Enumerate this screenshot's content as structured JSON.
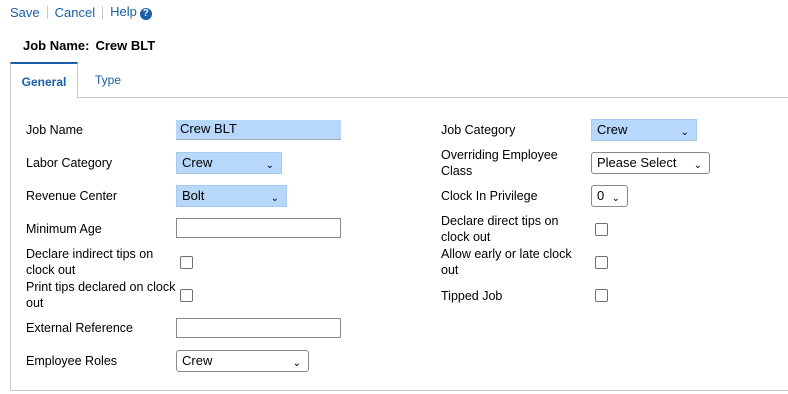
{
  "toolbar": {
    "save": "Save",
    "cancel": "Cancel",
    "help": "Help",
    "help_icon": "?"
  },
  "header": {
    "label": "Job Name:",
    "value": "Crew BLT"
  },
  "tabs": [
    {
      "label": "General"
    },
    {
      "label": "Type"
    }
  ],
  "form": {
    "job_name": {
      "label": "Job Name",
      "value": "Crew BLT"
    },
    "labor_category": {
      "label": "Labor Category",
      "value": "Crew"
    },
    "revenue_center": {
      "label": "Revenue Center",
      "value": "Bolt"
    },
    "minimum_age": {
      "label": "Minimum Age",
      "value": ""
    },
    "declare_indirect_tips": {
      "label": "Declare indirect tips on clock out",
      "checked": false
    },
    "print_tips": {
      "label": "Print tips declared on clock out",
      "checked": false
    },
    "external_reference": {
      "label": "External Reference",
      "value": ""
    },
    "employee_roles": {
      "label": "Employee Roles",
      "value": "Crew"
    },
    "job_category": {
      "label": "Job Category",
      "value": "Crew"
    },
    "overriding_employee_class": {
      "label": "Overriding Employee Class",
      "value": "Please Select"
    },
    "clock_in_privilege": {
      "label": "Clock In Privilege",
      "value": "0"
    },
    "declare_direct_tips": {
      "label": "Declare direct tips on clock out",
      "checked": false
    },
    "allow_early_late": {
      "label": "Allow early or late clock out",
      "checked": false
    },
    "tipped_job": {
      "label": "Tipped Job",
      "checked": false
    }
  },
  "colors": {
    "link": "#1a5fa8",
    "field_highlight": "#b7d7fb"
  },
  "icons": {
    "select_arrow": "chevron-down-icon"
  }
}
